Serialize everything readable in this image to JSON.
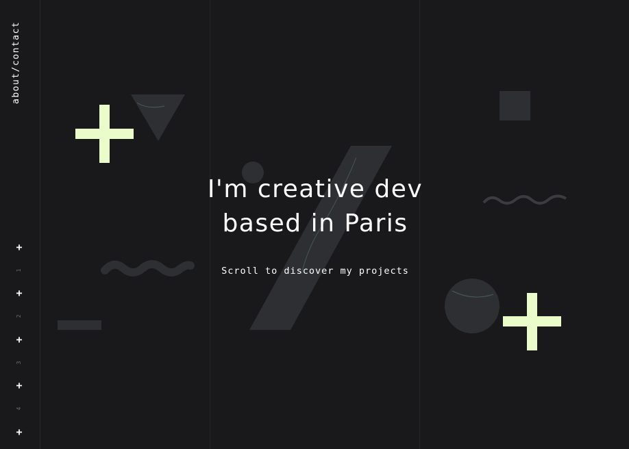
{
  "sidebar": {
    "about_link": "about/contact",
    "nav_items": [
      {
        "label": "+"
      },
      {
        "number": "1"
      },
      {
        "label": "+"
      },
      {
        "number": "2"
      },
      {
        "label": "+"
      },
      {
        "number": "3"
      },
      {
        "label": "+"
      },
      {
        "number": "4"
      },
      {
        "label": "+"
      }
    ]
  },
  "hero": {
    "title_line1": "I'm creative dev",
    "title_line2": "based in Paris",
    "subtitle": "Scroll to discover my projects"
  },
  "colors": {
    "background": "#19191b",
    "accent": "#eafcc9",
    "marble": "#2e2f33"
  }
}
